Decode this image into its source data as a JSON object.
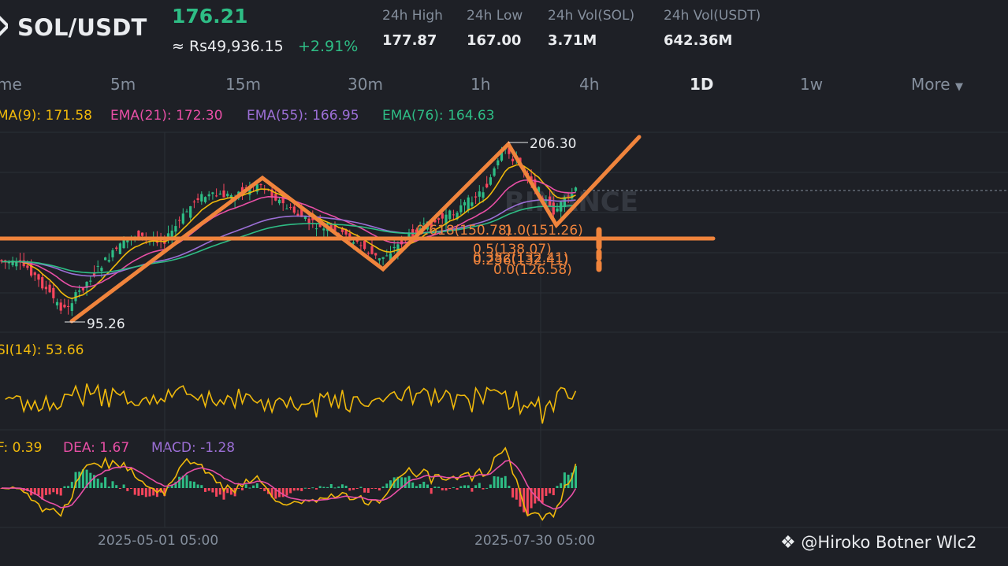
{
  "header": {
    "pair": "SOL/USDT",
    "last_price": "176.21",
    "fiat_price": "≈ Rs49,936.15",
    "change": "+2.91%",
    "stats": [
      {
        "label": "24h High",
        "value": "177.87"
      },
      {
        "label": "24h Low",
        "value": "167.00"
      },
      {
        "label": "24h Vol(SOL)",
        "value": "3.71M"
      },
      {
        "label": "24h Vol(USDT)",
        "value": "642.36M"
      }
    ]
  },
  "timeframes": [
    "me",
    "5m",
    "15m",
    "30m",
    "1h",
    "4h",
    "1D",
    "1w",
    "More"
  ],
  "active_timeframe": "1D",
  "indicators": {
    "ema9": "MA(9): 171.58",
    "ema21": "EMA(21): 172.30",
    "ema55": "EMA(55): 166.95",
    "ema76": "EMA(76): 164.63",
    "rsi": "SI(14): 53.66",
    "dif": "F: 0.39",
    "dea": "DEA: 1.67",
    "macd": "MACD: -1.28"
  },
  "colors": {
    "up": "#2ebd85",
    "down": "#f6465d",
    "ema9": "#f0b90b",
    "ema21": "#e84fa6",
    "ema55": "#9c6fd6",
    "ema76": "#2ebd85",
    "drawing": "#f0843c"
  },
  "chart_data": {
    "type": "candlestick",
    "price_annotations": {
      "high": "206.30",
      "low": "95.26"
    },
    "fib_levels": [
      {
        "label": "0.618(150.78)",
        "value": 150.78
      },
      {
        "label": "1.0(151.26)",
        "value": 151.26
      },
      {
        "label": "0.5(138.07)",
        "value": 138.07
      },
      {
        "label": "0.382(132.41)",
        "value": 132.41
      },
      {
        "label": "0.236(132.41)",
        "value": 132.41
      },
      {
        "label": "0.0(126.58)",
        "value": 126.58
      }
    ],
    "x_ticks": [
      "2025-05-01 05:00",
      "2025-07-30 05:00"
    ],
    "current_price": 176.21
  },
  "icons": {
    "watermark": "binance-diamond-icon",
    "more": "caret-down-icon"
  },
  "watermark": "@Hiroko Botner Wlc2"
}
